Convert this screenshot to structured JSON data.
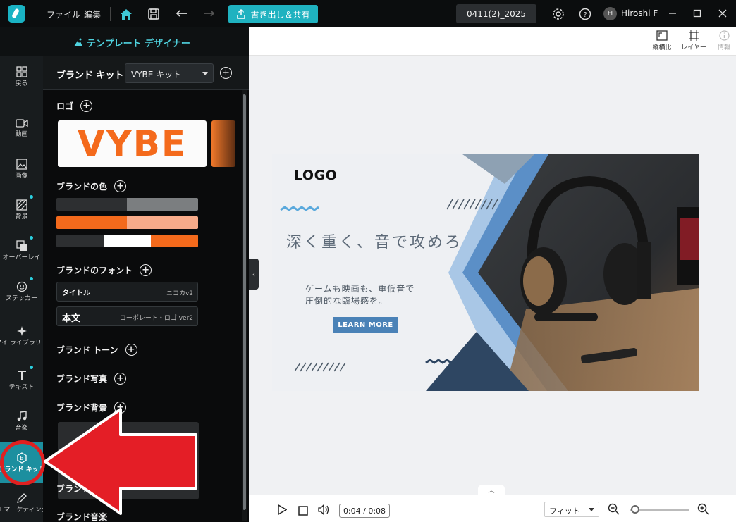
{
  "topbar": {
    "menu": [
      "ファイル",
      "編集"
    ],
    "export_label": "書き出し＆共有",
    "project_name": "0411(2)_2025",
    "user_initial": "H",
    "user_name": "Hiroshi F",
    "icons": [
      "home-icon",
      "save-icon",
      "undo-icon",
      "redo-icon",
      "settings-icon",
      "help-icon",
      "minimize-icon",
      "maximize-icon",
      "close-icon"
    ]
  },
  "designer": {
    "title": "テンプレート デザイナー"
  },
  "rail": {
    "items": [
      {
        "label": "戻る",
        "icon": "grid-icon"
      },
      {
        "label": "動画",
        "icon": "video-icon"
      },
      {
        "label": "画像",
        "icon": "image-icon"
      },
      {
        "label": "背景",
        "icon": "background-icon"
      },
      {
        "label": "オーバーレイ",
        "icon": "overlay-icon"
      },
      {
        "label": "ステッカー",
        "icon": "sticker-icon"
      },
      {
        "label": "マイ ライブラリー",
        "icon": "sparkle-icon"
      },
      {
        "label": "テキスト",
        "icon": "text-icon"
      },
      {
        "label": "音楽",
        "icon": "music-icon"
      },
      {
        "label": "ブランド キット",
        "icon": "brand-kit-icon"
      },
      {
        "label": "AI マーケティング",
        "icon": "pen-icon"
      }
    ]
  },
  "panel": {
    "title": "ブランド キット",
    "kit_value": "VYBE キット",
    "logo_label": "ロゴ",
    "logo_text": "VYBE",
    "colors_label": "ブランドの色",
    "color_palettes": [
      [
        "#2d2f31",
        "#7b7e80"
      ],
      [
        "#f46a1c",
        "#f7ab8a"
      ],
      [
        "#2d2f31",
        "#ffffff",
        "#f46a1c"
      ]
    ],
    "fonts_label": "ブランドのフォント",
    "fonts": [
      {
        "name": "タイトル",
        "value": "ニコカv2"
      },
      {
        "name": "本文",
        "value": "コーポレート・ロゴ ver2"
      }
    ],
    "tone_label": "ブランド トーン",
    "photo_label": "ブランド写真",
    "background_label": "ブランド背景",
    "partial_label_1": "ブランド",
    "partial_label_2": "ブランド音楽"
  },
  "right_tools": {
    "aspect_label": "縦横比",
    "layer_label": "レイヤー",
    "info_label": "情報"
  },
  "canvas": {
    "logo_text": "LOGO",
    "headline": "深く重く、音で攻めろ",
    "body_line1": "ゲームも映画も、重低音で",
    "body_line2": "圧倒的な臨場感を。",
    "button_label": "LEARN MORE",
    "accent_color": "#4a82b7",
    "dark_color": "#2e4662"
  },
  "bottombar": {
    "time": "0:04 / 0:08",
    "fit_value": "フィット",
    "zoom_fraction": 0.05
  },
  "annotation": {
    "highlight_color": "#e02020"
  }
}
